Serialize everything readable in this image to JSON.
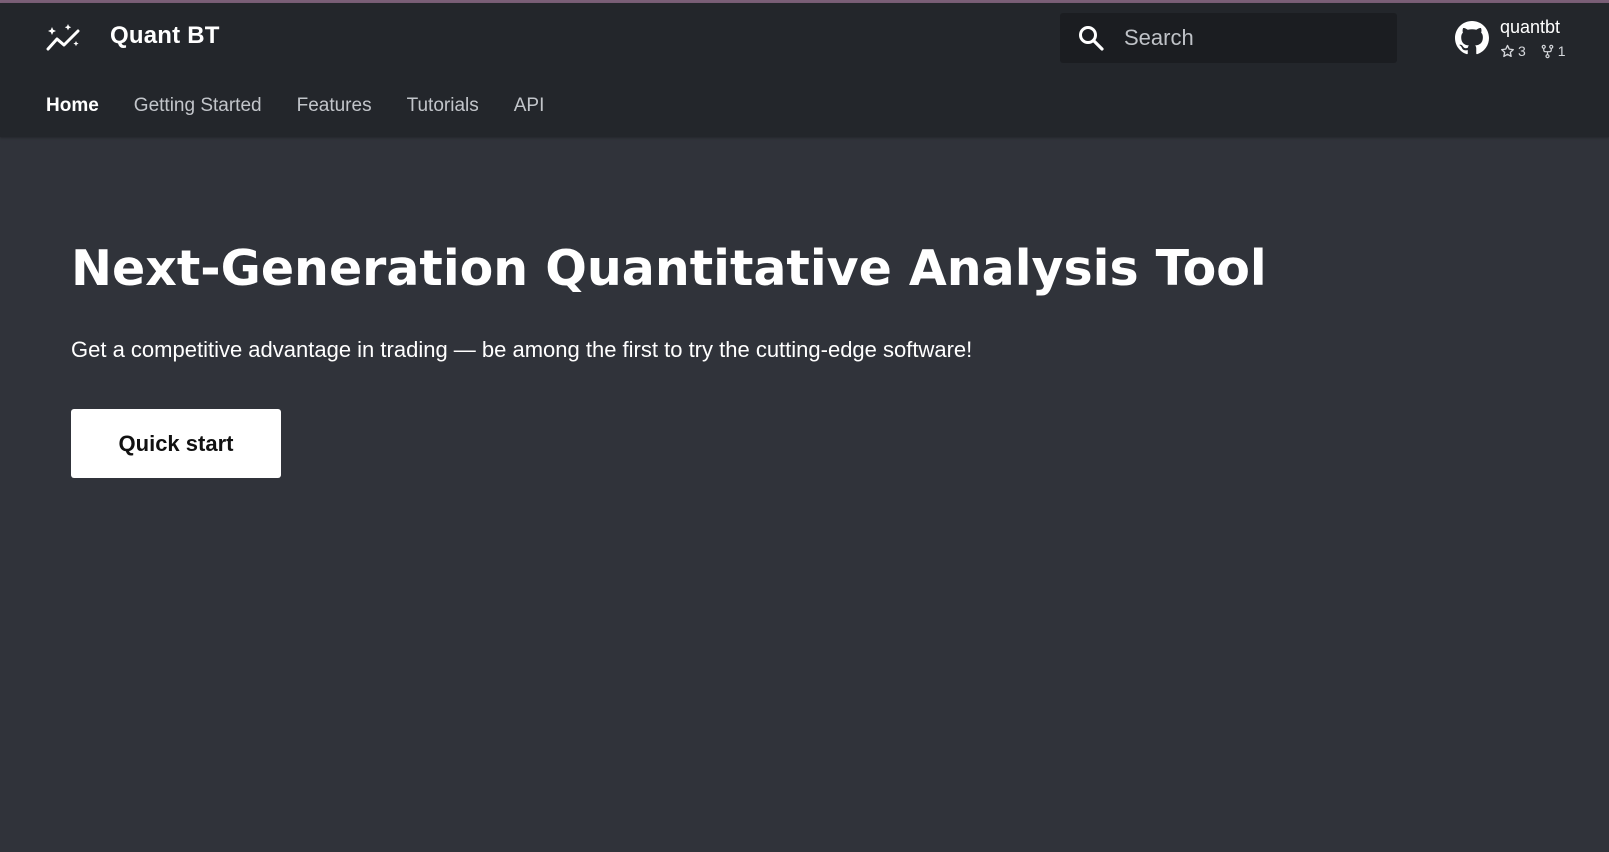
{
  "header": {
    "site_title": "Quant BT",
    "logo_icon": "auto-graph-icon",
    "search": {
      "placeholder": "Search",
      "value": ""
    },
    "repo": {
      "name": "quantbt",
      "stars": "3",
      "forks": "1"
    }
  },
  "nav": {
    "items": [
      {
        "label": "Home",
        "active": true
      },
      {
        "label": "Getting Started",
        "active": false
      },
      {
        "label": "Features",
        "active": false
      },
      {
        "label": "Tutorials",
        "active": false
      },
      {
        "label": "API",
        "active": false
      }
    ]
  },
  "hero": {
    "title": "Next-Generation Quantitative Analysis Tool",
    "subtitle": "Get a competitive advantage in trading — be among the first to try the cutting-edge software!",
    "cta_label": "Quick start"
  },
  "colors": {
    "background": "#30333a",
    "header": "#23262b",
    "search_bg": "#1b1d21",
    "accent_line": "#7a5f77"
  }
}
